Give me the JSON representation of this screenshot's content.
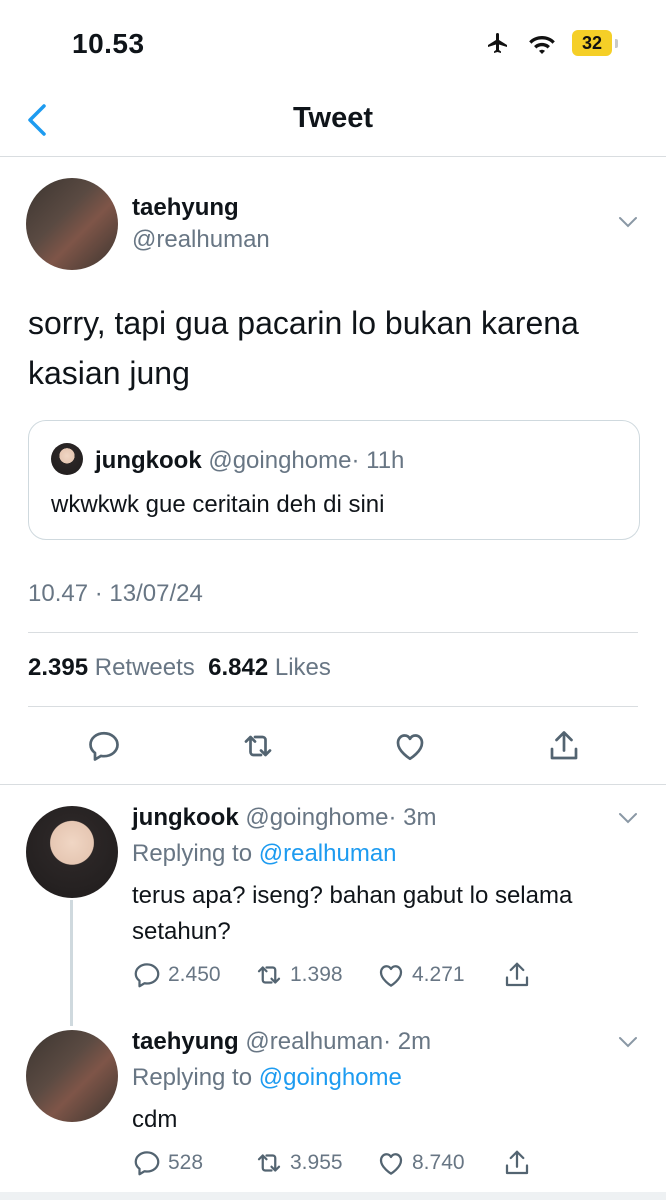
{
  "status_bar": {
    "time": "10.53",
    "battery": "32"
  },
  "nav": {
    "title": "Tweet"
  },
  "tweet": {
    "author_name": "taehyung",
    "author_handle": "@realhuman",
    "text": "sorry, tapi gua pacarin lo bukan karena kasian jung",
    "quoted": {
      "author_name": "jungkook",
      "author_handle": "@goinghome",
      "time": "· 11h",
      "text": "wkwkwk gue ceritain deh di sini"
    },
    "timestamp": "10.47 · 13/07/24",
    "retweets_count": "2.395",
    "retweets_label": "Retweets",
    "likes_count": "6.842",
    "likes_label": "Likes"
  },
  "replies": [
    {
      "author_name": "jungkook",
      "author_handle": "@goinghome",
      "time": "· 3m",
      "replying_prefix": "Replying to",
      "replying_to": "@realhuman",
      "text": "terus apa? iseng? bahan gabut lo selama setahun?",
      "reply_count": "2.450",
      "retweet_count": "1.398",
      "like_count": "4.271"
    },
    {
      "author_name": "taehyung",
      "author_handle": "@realhuman",
      "time": "· 2m",
      "replying_prefix": "Replying to",
      "replying_to": "@goinghome",
      "text": "cdm",
      "reply_count": "528",
      "retweet_count": "3.955",
      "like_count": "8.740"
    }
  ],
  "colors": {
    "accent": "#1d9bf0",
    "muted": "#687684",
    "text": "#0f1419",
    "battery": "#f5cf27"
  },
  "icons": [
    "airplane-icon",
    "wifi-icon",
    "battery-icon",
    "back-chevron-icon",
    "chevron-down-icon",
    "reply-icon",
    "retweet-icon",
    "like-icon",
    "share-icon"
  ]
}
